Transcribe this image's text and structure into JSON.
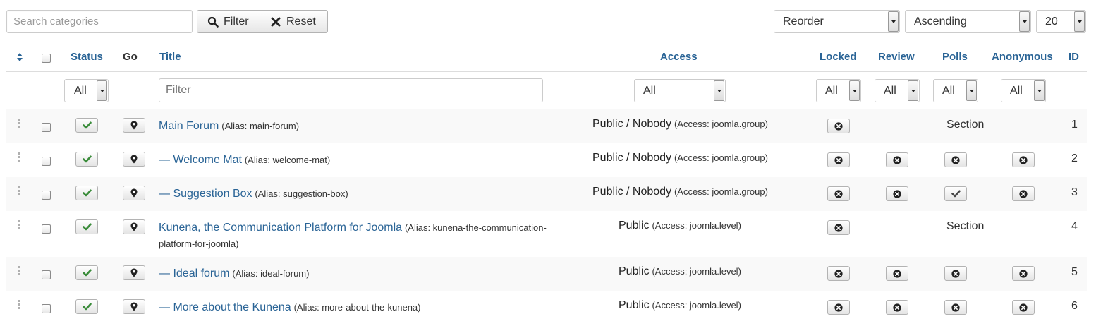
{
  "toolbar": {
    "search_placeholder": "Search categories",
    "filter_label": "Filter",
    "reset_label": "Reset",
    "ordering": "Reorder",
    "direction": "Ascending",
    "limit": "20"
  },
  "columns": {
    "status": "Status",
    "go": "Go",
    "title": "Title",
    "access": "Access",
    "locked": "Locked",
    "review": "Review",
    "polls": "Polls",
    "anonymous": "Anonymous",
    "id": "ID"
  },
  "filters": {
    "status": "All",
    "title_placeholder": "Filter",
    "access": "All",
    "locked": "All",
    "review": "All",
    "polls": "All",
    "anonymous": "All"
  },
  "rows": [
    {
      "title": "Main Forum",
      "alias_line1": "(Alias: main-forum)",
      "alias_line2": "",
      "access_main": "Public / Nobody",
      "access_sub": "(Access: joomla.group)",
      "polls_text": "Section",
      "id": "1"
    },
    {
      "title": "— Welcome Mat",
      "alias_line1": "(Alias: welcome-mat)",
      "alias_line2": "",
      "access_main": "Public / Nobody",
      "access_sub": "(Access: joomla.group)",
      "polls_text": "",
      "id": "2"
    },
    {
      "title": "— Suggestion Box",
      "alias_line1": "(Alias: suggestion-box)",
      "alias_line2": "",
      "access_main": "Public / Nobody",
      "access_sub": "(Access: joomla.group)",
      "polls_text": "",
      "id": "3"
    },
    {
      "title": "Kunena, the Communication Platform for Joomla",
      "alias_line1": "(Alias: kunena-the-communication-",
      "alias_line2": "platform-for-joomla)",
      "access_main": "Public",
      "access_sub": "(Access: joomla.level)",
      "polls_text": "Section",
      "id": "4"
    },
    {
      "title": "— Ideal forum",
      "alias_line1": "(Alias: ideal-forum)",
      "alias_line2": "",
      "access_main": "Public",
      "access_sub": "(Access: joomla.level)",
      "polls_text": "",
      "id": "5"
    },
    {
      "title": "— More about the Kunena",
      "alias_line1": "(Alias: more-about-the-kunena)",
      "alias_line2": "",
      "access_main": "Public",
      "access_sub": "(Access: joomla.level)",
      "polls_text": "",
      "id": "6"
    }
  ],
  "icons": {
    "search": "search-icon",
    "reset": "x-icon",
    "published": "check-icon",
    "go": "map-marker-icon",
    "off": "x-circle-icon",
    "sort": "sort-icon"
  },
  "colors": {
    "link": "#2a6496",
    "published_check": "#3a8c3a",
    "stripe": "#f9f9f9"
  }
}
